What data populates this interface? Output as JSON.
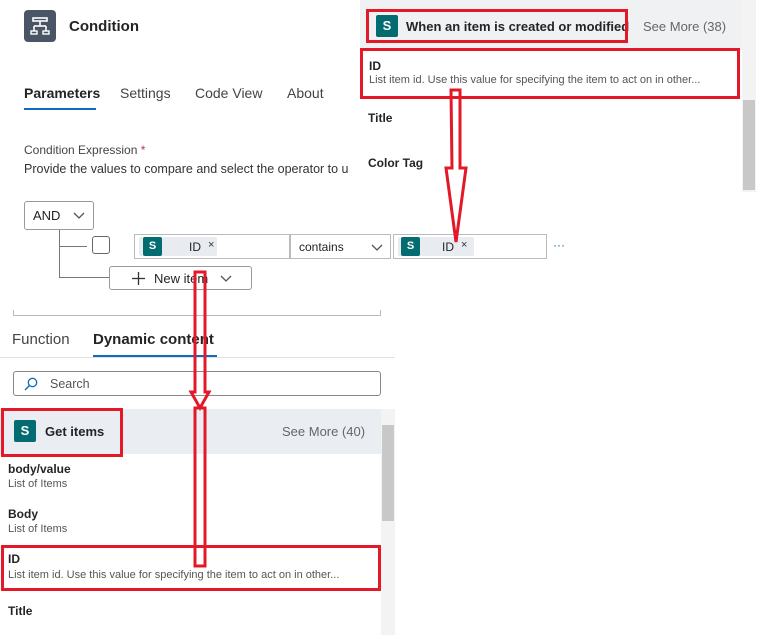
{
  "header": {
    "title": "Condition"
  },
  "tabs": [
    {
      "label": "Parameters",
      "active": true
    },
    {
      "label": "Settings"
    },
    {
      "label": "Code View"
    },
    {
      "label": "About"
    }
  ],
  "condition": {
    "label": "Condition Expression",
    "required_mark": "*",
    "description": "Provide the values to compare and select the operator to u",
    "logic_operator": "AND",
    "row": {
      "left_token": "ID",
      "operator": "contains",
      "right_token": "ID",
      "remove_symbol": "×",
      "more": "···"
    },
    "new_item_label": "New item"
  },
  "top_panel": {
    "trigger_name": "When an item is created or modified",
    "see_more": "See More (38)",
    "items": [
      {
        "title": "ID",
        "desc": "List item id. Use this value for specifying the item to act on in other..."
      },
      {
        "title": "Title",
        "desc": ""
      },
      {
        "title": "Color Tag",
        "desc": ""
      }
    ]
  },
  "dynamic_panel": {
    "tabs": [
      {
        "label": "Function"
      },
      {
        "label": "Dynamic content",
        "active": true
      }
    ],
    "search_placeholder": "Search",
    "group_name": "Get items",
    "see_more": "See More (40)",
    "items": [
      {
        "title": "body/value",
        "desc": "List of Items"
      },
      {
        "title": "Body",
        "desc": "List of Items"
      },
      {
        "title": "ID",
        "desc": "List item id. Use this value for specifying the item to act on in other..."
      },
      {
        "title": "Title",
        "desc": ""
      }
    ]
  },
  "icons": {
    "sharepoint": "S"
  },
  "colors": {
    "annotation_red": "#e3192a",
    "sharepoint_teal": "#036c70",
    "accent": "#0f6cbd"
  }
}
